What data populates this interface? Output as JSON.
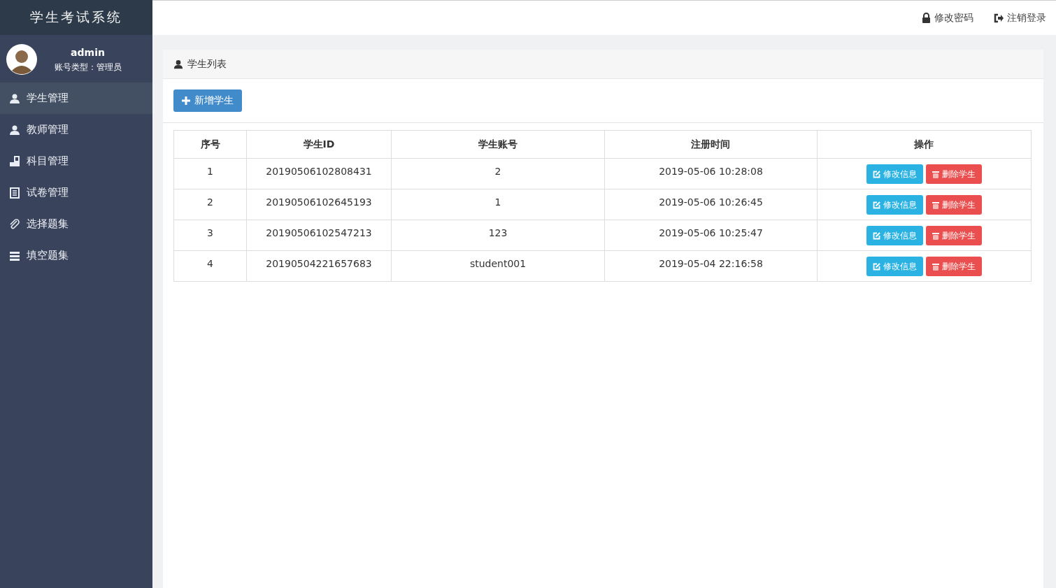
{
  "app_title": "学生考试系统",
  "user": {
    "name": "admin",
    "role": "账号类型：管理员"
  },
  "sidebar": {
    "items": [
      {
        "label": "学生管理",
        "selected": true
      },
      {
        "label": "教师管理",
        "selected": false
      },
      {
        "label": "科目管理",
        "selected": false
      },
      {
        "label": "试卷管理",
        "selected": false
      },
      {
        "label": "选择题集",
        "selected": false
      },
      {
        "label": "填空题集",
        "selected": false
      }
    ]
  },
  "topbar": {
    "links": [
      "修改密码",
      "注销登录"
    ]
  },
  "panel": {
    "title": "学生列表",
    "add_button": "新增学生",
    "table": {
      "columns": [
        "序号",
        "学生ID",
        "学生账号",
        "注册时间",
        "操作"
      ],
      "rows": [
        {
          "cells": [
            "1",
            "20190506102808431",
            "2",
            "2019-05-06 10:28:08"
          ],
          "actions": [
            "修改信息",
            "删除学生"
          ]
        },
        {
          "cells": [
            "2",
            "20190506102645193",
            "1",
            "2019-05-06 10:26:45"
          ],
          "actions": [
            "修改信息",
            "删除学生"
          ]
        },
        {
          "cells": [
            "3",
            "20190506102547213",
            "123",
            "2019-05-06 10:25:47"
          ],
          "actions": [
            "修改信息",
            "删除学生"
          ]
        },
        {
          "cells": [
            "4",
            "20190504221657683",
            "student001",
            "2019-05-04 22:16:58"
          ],
          "actions": [
            "修改信息",
            "删除学生"
          ]
        }
      ]
    }
  }
}
